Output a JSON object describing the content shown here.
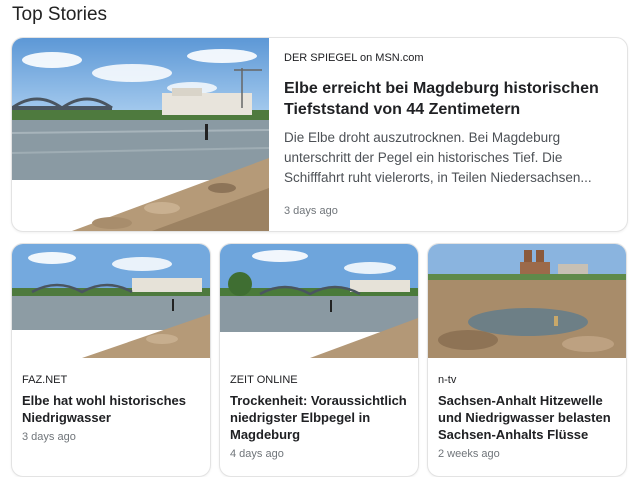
{
  "section": {
    "title": "Top Stories"
  },
  "featured": {
    "source": "DER SPIEGEL on MSN.com",
    "headline": "Elbe erreicht bei Magdeburg historischen Tiefststand von 44 Zentimetern",
    "snippet": "Die Elbe droht auszutrocknen. Bei Magdeburg unterschritt der Pegel ein historisches Tief. Die Schifffahrt ruht vielerorts, in Teilen Niedersachsen...",
    "time": "3 days ago"
  },
  "stories": [
    {
      "source": "FAZ.NET",
      "headline": "Elbe hat wohl historisches Niedrigwasser",
      "time": "3 days ago"
    },
    {
      "source": "ZEIT ONLINE",
      "headline": "Trockenheit: Voraussichtlich niedrigster Elbpegel in Magdeburg",
      "time": "4 days ago"
    },
    {
      "source": "n-tv",
      "headline": "Sachsen-Anhalt Hitzewelle und Niedrigwasser belasten Sachsen-Anhalts Flüsse",
      "time": "2 weeks ago"
    }
  ],
  "colors": {
    "sky": "#6fa6dd",
    "water": "#8a9aa3",
    "rocks": "#b59a78",
    "link": "#202124",
    "muted": "#70757a"
  }
}
